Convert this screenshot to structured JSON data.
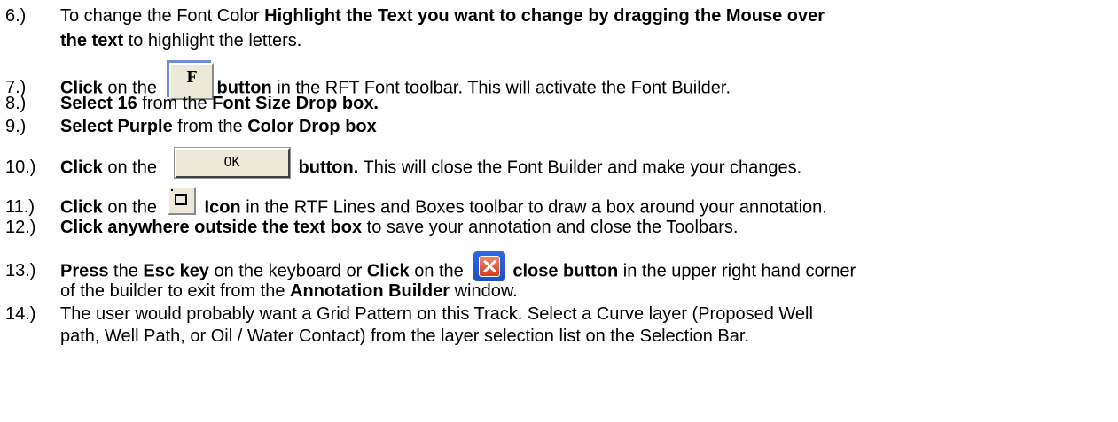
{
  "steps": [
    {
      "num": "6.)",
      "t1": "To change the Font Color ",
      "b1": "Highlight the Text you want to change by dragging the Mouse over",
      "b2": "the text",
      "t2": " to highlight the letters."
    },
    {
      "num": "7.)",
      "b1": "Click",
      "t1": " on the ",
      "icon": "font-f-button",
      "icon_label": "F",
      "b2": "button",
      "t2": " in the RFT Font toolbar. This will activate the Font Builder."
    },
    {
      "num": "8.)",
      "b1": "Select 16",
      "t1": " from the ",
      "b2": "Font Size Drop box."
    },
    {
      "num": "9.)",
      "b1": "Select Purple",
      "t1": " from the ",
      "b2": "Color Drop box"
    },
    {
      "num": "10.)",
      "b1": "Click",
      "t1": " on the ",
      "icon": "ok-button",
      "icon_label": "OK",
      "b2": "button.",
      "t2": " This will close the Font Builder and make your changes."
    },
    {
      "num": "11.)",
      "b1": "Click",
      "t1": " on the ",
      "icon": "box-icon",
      "b2": "Icon",
      "t2": " in the RTF Lines and Boxes toolbar to draw a box around your annotation."
    },
    {
      "num": "12.)",
      "b1": "Click anywhere outside the text box",
      "t1": " to save your annotation and close the Toolbars."
    },
    {
      "num": "13.)",
      "b1": "Press",
      "t1": " the ",
      "b2": "Esc key",
      "t2": " on the keyboard or ",
      "b3": "Click",
      "t3": " on the ",
      "icon": "close-icon",
      "b4": "close button",
      "t4": " in the upper right hand corner",
      "t5": "of the builder to exit from the ",
      "b5": "Annotation Builder",
      "t6": " window."
    },
    {
      "num": "14.)",
      "t1": "The user would probably want a Grid Pattern on this Track. Select a Curve layer (Proposed Well",
      "t2": "path, Well Path, or Oil / Water Contact) from the layer selection list on the Selection Bar."
    }
  ]
}
